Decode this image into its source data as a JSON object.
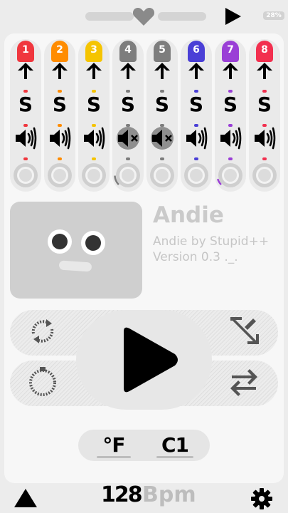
{
  "status": {
    "battery": "28%"
  },
  "channels": [
    {
      "number": "1",
      "color": "#f0373e",
      "solo": "S",
      "muted": false,
      "progress": 0.0
    },
    {
      "number": "2",
      "color": "#ff8c00",
      "solo": "S",
      "muted": false,
      "progress": 0.0
    },
    {
      "number": "3",
      "color": "#f5c400",
      "solo": "S",
      "muted": false,
      "progress": 0.0
    },
    {
      "number": "4",
      "color": "#7d7d7d",
      "solo": "S",
      "muted": true,
      "progress": 0.12
    },
    {
      "number": "5",
      "color": "#7d7d7d",
      "solo": "S",
      "muted": true,
      "progress": 0.0
    },
    {
      "number": "6",
      "color": "#4a3fd6",
      "solo": "S",
      "muted": false,
      "progress": 0.0
    },
    {
      "number": "7",
      "color": "#9a3fd6",
      "solo": "S",
      "muted": false,
      "progress": 0.08
    },
    {
      "number": "8",
      "color": "#f2304f",
      "solo": "S",
      "muted": false,
      "progress": 0.0
    }
  ],
  "preset": {
    "name": "Andie",
    "author_line": "Andie by Stupid++",
    "version_line": "Version 0.3 ._."
  },
  "units": {
    "temperature": "°F",
    "channel": "C1"
  },
  "tempo": {
    "value": "128",
    "unit": "Bpm"
  },
  "icons": {
    "top": [
      "heart-icon",
      "play-icon"
    ],
    "transport": [
      "loop-icon",
      "shuffle-icon",
      "record-icon",
      "swap-icon",
      "play-icon"
    ],
    "bottom": [
      "metronome-icon",
      "gear-icon"
    ]
  }
}
